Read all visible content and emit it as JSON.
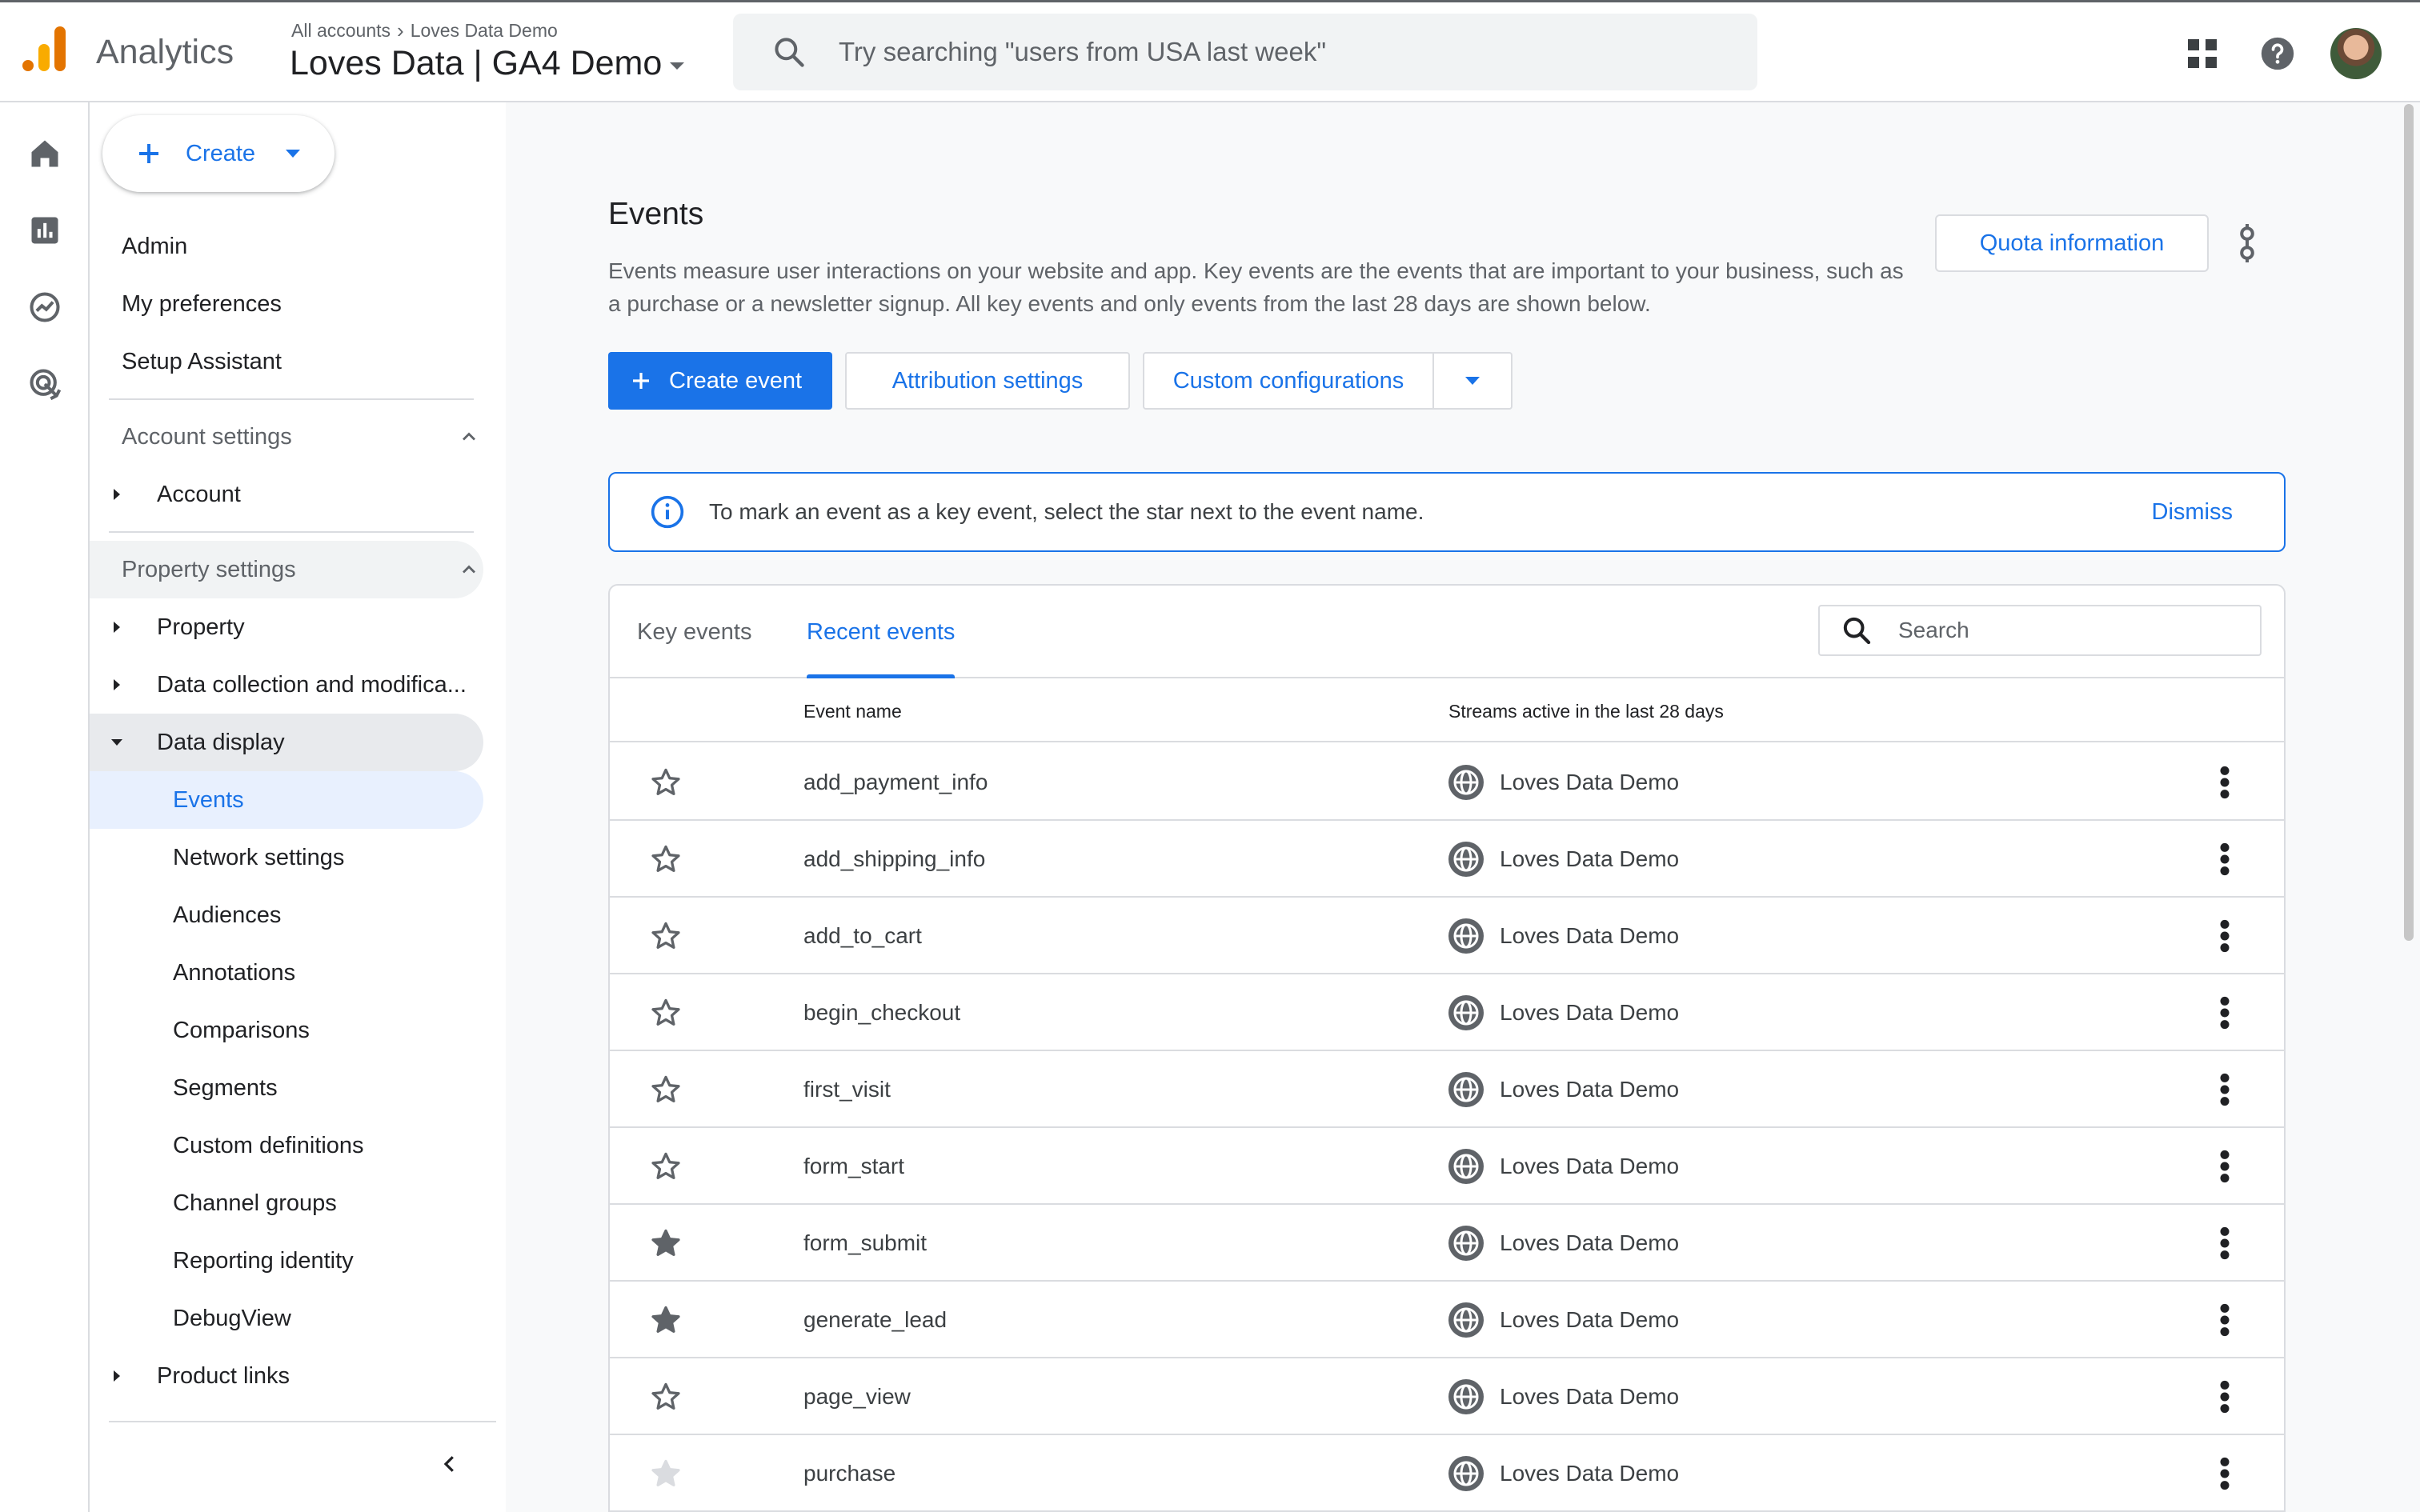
{
  "app": {
    "name": "Analytics",
    "breadcrumb_root": "All accounts",
    "breadcrumb_account": "Loves Data Demo",
    "property_name": "Loves Data | GA4 Demo"
  },
  "search": {
    "placeholder": "Try searching \"users from USA last week\""
  },
  "nav": {
    "create_label": "Create",
    "top_items": [
      "Admin",
      "My preferences",
      "Setup Assistant"
    ],
    "account_settings": {
      "label": "Account settings",
      "items": [
        "Account"
      ]
    },
    "property_settings": {
      "label": "Property settings",
      "property": "Property",
      "data_collection": "Data collection and modifica...",
      "data_display": "Data display",
      "data_display_items": [
        "Events",
        "Network settings",
        "Audiences",
        "Annotations",
        "Comparisons",
        "Segments",
        "Custom definitions",
        "Channel groups",
        "Reporting identity",
        "DebugView"
      ],
      "product_links": "Product links"
    }
  },
  "page": {
    "title": "Events",
    "description": "Events measure user interactions on your website and app. Key events are the events that are important to your business, such as a purchase or a newsletter signup. All key events and only events from the last 28 days are shown below.",
    "quota_button": "Quota information",
    "create_event_button": "Create event",
    "attribution_button": "Attribution settings",
    "custom_config_button": "Custom configurations"
  },
  "banner": {
    "message": "To mark an event as a key event, select the star next to the event name.",
    "dismiss": "Dismiss"
  },
  "table": {
    "tabs": [
      "Key events",
      "Recent events"
    ],
    "active_tab": "Recent events",
    "search_placeholder": "Search",
    "columns": [
      "Event name",
      "Streams active in the last 28 days"
    ],
    "rows": [
      {
        "name": "add_payment_info",
        "stream": "Loves Data Demo",
        "key_event": false
      },
      {
        "name": "add_shipping_info",
        "stream": "Loves Data Demo",
        "key_event": false
      },
      {
        "name": "add_to_cart",
        "stream": "Loves Data Demo",
        "key_event": false
      },
      {
        "name": "begin_checkout",
        "stream": "Loves Data Demo",
        "key_event": false
      },
      {
        "name": "first_visit",
        "stream": "Loves Data Demo",
        "key_event": false
      },
      {
        "name": "form_start",
        "stream": "Loves Data Demo",
        "key_event": false
      },
      {
        "name": "form_submit",
        "stream": "Loves Data Demo",
        "key_event": true
      },
      {
        "name": "generate_lead",
        "stream": "Loves Data Demo",
        "key_event": true
      },
      {
        "name": "page_view",
        "stream": "Loves Data Demo",
        "key_event": false
      },
      {
        "name": "purchase",
        "stream": "Loves Data Demo",
        "key_event": true,
        "disabled": true
      }
    ]
  },
  "colors": {
    "accent": "#1a73e8",
    "logo_orange": "#e37400",
    "logo_yellow": "#f9ab00"
  },
  "icons": [
    "search-icon",
    "apps-grid-icon",
    "help-icon",
    "home-icon",
    "reports-icon",
    "explore-icon",
    "advertising-icon",
    "settings-gear-icon",
    "star-icon",
    "globe-icon",
    "more-vert-icon",
    "info-icon",
    "chevron-up-icon",
    "chevron-left-icon"
  ]
}
